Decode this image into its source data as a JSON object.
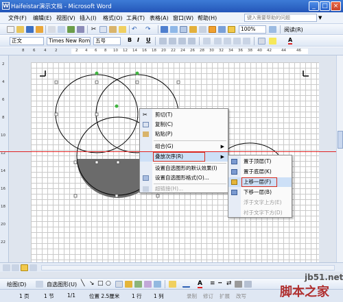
{
  "window": {
    "title": "Haifeistar演示文档 - Microsoft Word",
    "minimize_glyph": "_",
    "maximize_glyph": "□",
    "close_glyph": "×",
    "app_icon_glyph": "W"
  },
  "menu": {
    "items": [
      "文件(F)",
      "编辑(E)",
      "视图(V)",
      "插入(I)",
      "格式(O)",
      "工具(T)",
      "表格(A)",
      "窗口(W)",
      "帮助(H)"
    ],
    "help_placeholder": "键入需要帮助的问题"
  },
  "standard_toolbar": {
    "zoom": "100%",
    "reading_label": "阅读(R)"
  },
  "format_toolbar": {
    "style": "正文",
    "font": "Times New Roma",
    "size": "五号",
    "bold": "B",
    "italic": "I",
    "underline": "U",
    "font_color_letter": "A"
  },
  "ruler": {
    "h_ticks": [
      "8",
      "6",
      "4",
      "2",
      "2",
      "4",
      "6",
      "8",
      "10",
      "12",
      "14",
      "16",
      "18",
      "20",
      "22",
      "24",
      "26",
      "28",
      "30",
      "32",
      "34",
      "36",
      "38",
      "40",
      "42",
      "44",
      "46"
    ],
    "v_ticks": [
      "2",
      "4",
      "6",
      "8",
      "10",
      "12",
      "14",
      "16",
      "18",
      "20",
      "22"
    ]
  },
  "context_menu": {
    "items": [
      {
        "label": "剪切(T)",
        "icon": "scissors-icon",
        "disabled": false
      },
      {
        "label": "复制(C)",
        "icon": "copy-icon",
        "disabled": false
      },
      {
        "label": "粘贴(P)",
        "icon": "paste-icon",
        "disabled": false
      },
      {
        "label": "组合(G)",
        "icon": "",
        "disabled": false,
        "submenu": true
      },
      {
        "label": "叠放次序(R)",
        "icon": "",
        "disabled": false,
        "submenu": true,
        "highlighted": true
      },
      {
        "label": "设置自选图形的默认效果(I)",
        "icon": "",
        "disabled": false
      },
      {
        "label": "设置自选图形格式(O)...",
        "icon": "format-shape-icon",
        "disabled": false
      },
      {
        "label": "超链接(H)...",
        "icon": "hyperlink-icon",
        "disabled": true
      }
    ]
  },
  "submenu": {
    "items": [
      {
        "label": "置于顶层(T)",
        "icon": "bring-to-front-icon",
        "disabled": false
      },
      {
        "label": "置于底层(K)",
        "icon": "send-to-back-icon",
        "disabled": false
      },
      {
        "label": "上移一层(F)",
        "icon": "bring-forward-icon",
        "disabled": false,
        "highlighted": true
      },
      {
        "label": "下移一层(B)",
        "icon": "send-backward-icon",
        "disabled": false
      },
      {
        "label": "浮于文字上方(E)",
        "icon": "",
        "disabled": true
      },
      {
        "label": "衬于文字下方(D)",
        "icon": "",
        "disabled": true
      }
    ]
  },
  "draw_toolbar": {
    "draw_label": "绘图(D)",
    "autoshapes_label": "自选图形(U)"
  },
  "status_bar": [
    "1 页",
    "1 节",
    "1/1",
    "位置 2.5厘米",
    "1 行",
    "1 列",
    "录制",
    "修订",
    "扩展",
    "改写"
  ],
  "watermark": {
    "line1": "jb51.net",
    "line2": "脚本之家"
  },
  "colors": {
    "title_bar": "#2456b9",
    "highlight": "#cde0f7",
    "annotation_red": "#d42a1c",
    "shape_fill": "#6b6b6b"
  }
}
